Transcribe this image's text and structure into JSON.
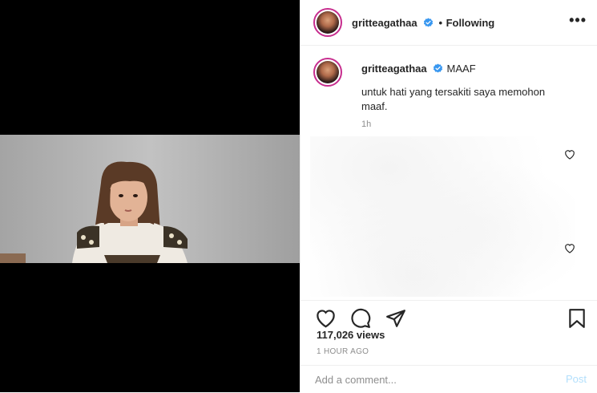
{
  "post": {
    "username": "gritteagathaa",
    "follow_separator": "•",
    "follow_status": "Following",
    "more_icon": "more-horizontal-icon",
    "verified_icon": "verified-badge-icon"
  },
  "caption": {
    "username": "gritteagathaa",
    "title": "MAAF",
    "text": "untuk hati yang tersakiti saya memohon maaf.",
    "time": "1h"
  },
  "stats": {
    "views": "117,026 views",
    "time_ago": "1 HOUR AGO"
  },
  "actions": {
    "icons": [
      "heart-icon",
      "comment-icon",
      "share-icon",
      "bookmark-icon"
    ]
  },
  "comment": {
    "placeholder": "Add a comment...",
    "post_label": "Post"
  },
  "colors": {
    "verified": "#3897f0",
    "post_disabled": "#b2dffc",
    "story_ring": "#c72d8e",
    "text": "#262626",
    "muted": "#8e8e8e"
  }
}
